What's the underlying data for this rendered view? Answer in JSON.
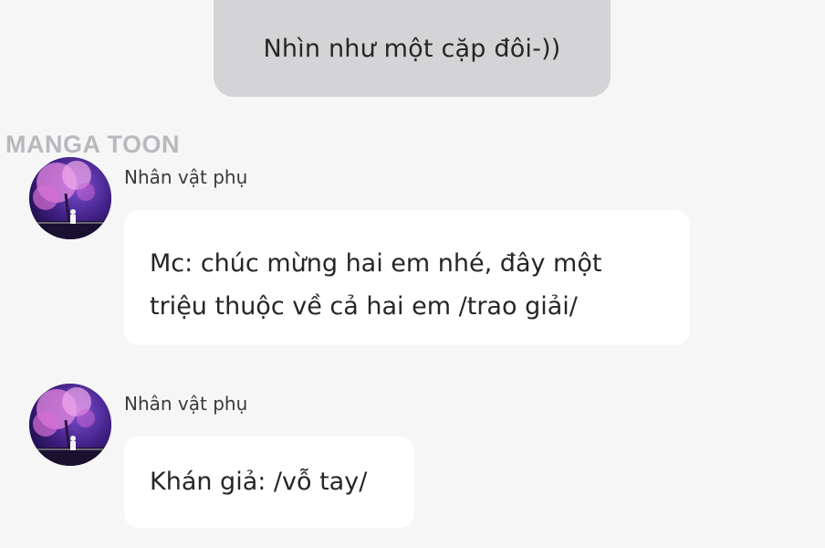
{
  "top_message": {
    "text": "Nhìn như một cặp đôi-))"
  },
  "watermark": {
    "text": "MANGA TOON"
  },
  "messages": [
    {
      "speaker": "Nhân vật phụ",
      "avatar_icon": "cherry-blossom-night-avatar",
      "lines": [
        "Mc: chúc mừng hai em nhé, đây một",
        "triệu thuộc về cả hai em /trao giải/"
      ]
    },
    {
      "speaker": "Nhân vật phụ",
      "avatar_icon": "cherry-blossom-night-avatar",
      "lines": [
        "Khán giả: /vỗ tay/"
      ]
    }
  ],
  "colors": {
    "background": "#f6f6f7",
    "top_bubble": "#d4d4d6",
    "message_bubble": "#ffffff",
    "avatar_base": "#3a1f74",
    "blossom": "#e58ae0"
  }
}
